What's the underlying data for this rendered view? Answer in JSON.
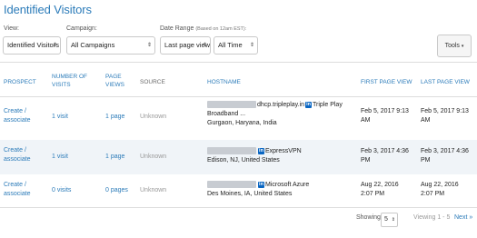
{
  "page_title": "Identified Visitors",
  "filters": {
    "view_label": "View:",
    "view_value": "Identified Visitors",
    "campaign_label": "Campaign:",
    "campaign_value": "All Campaigns",
    "date_range_label": "Date Range",
    "date_range_note": "(Based on 12am EST):",
    "date_range_value": "Last page view",
    "date_range_period": "All Time"
  },
  "tools_label": "Tools",
  "columns": {
    "prospect": "PROSPECT",
    "visits": "NUMBER OF VISITS",
    "views": "PAGE VIEWS",
    "source": "SOURCE",
    "hostname": "HOSTNAME",
    "first": "FIRST PAGE VIEW",
    "last": "LAST PAGE VIEW"
  },
  "rows": [
    {
      "prospect": "Create / associate",
      "visits": "1 visit",
      "views": "1 page",
      "source": "Unknown",
      "host_suffix": "dhcp.tripleplay.in",
      "company": "Triple Play Broadband ...",
      "location": "Gurgaon, Haryana, India",
      "first": "Feb 5, 2017 9:13 AM",
      "last": "Feb 5, 2017 9:13 AM"
    },
    {
      "prospect": "Create / associate",
      "visits": "1 visit",
      "views": "1 page",
      "source": "Unknown",
      "host_suffix": "",
      "company": "ExpressVPN",
      "location": "Edison, NJ, United States",
      "first": "Feb 3, 2017 4:36 PM",
      "last": "Feb 3, 2017 4:36 PM"
    },
    {
      "prospect": "Create / associate",
      "visits": "0 visits",
      "views": "0 pages",
      "source": "Unknown",
      "host_suffix": "",
      "company": "Microsoft Azure",
      "location": "Des Moines, IA, United States",
      "first": "Aug 22, 2016 2:07 PM",
      "last": "Aug 22, 2016 2:07 PM"
    }
  ],
  "pagination": {
    "showing_label": "Showing",
    "page_size": "5",
    "range": "Viewing 1 - 5",
    "next": "Next »"
  },
  "icons": {
    "linkedin": "linkedin-icon",
    "select_caret": "updown-caret-icon",
    "tools_caret": "chevron-down-icon"
  },
  "colors": {
    "link": "#2b7bb9",
    "alt_row": "#f0f4f8",
    "linkedin": "#0a66c2"
  }
}
